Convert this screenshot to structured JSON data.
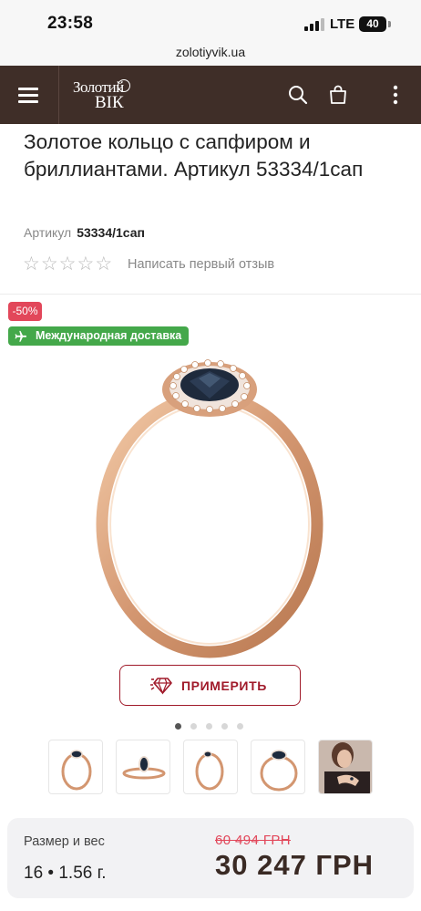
{
  "status_bar": {
    "time": "23:58",
    "network": "LTE",
    "battery": "40"
  },
  "browser": {
    "url": "zolotiyvik.ua"
  },
  "header": {
    "logo_line1": "Золотий",
    "logo_line2": "ВІК",
    "icons": [
      "menu-icon",
      "search-icon",
      "cart-icon",
      "more-vertical-icon"
    ],
    "background_color": "#3f2e28"
  },
  "product": {
    "title": "Золотое кольцо с сапфиром и бриллиантами. Артикул 53334/1сап",
    "sku_label": "Артикул",
    "sku_value": "53334/1сап",
    "rating_stars": 0,
    "rating_max": 5,
    "review_link": "Написать первый отзыв",
    "discount_badge": "-50%",
    "delivery_badge": "Международная доставка",
    "try_on_label": "ПРИМЕРИТЬ",
    "gallery_count": 5,
    "gallery_active": 0
  },
  "price_bar": {
    "size_weight_label": "Размер и вес",
    "size_weight_value": "16 • 1.56 г.",
    "old_price": "60 494 ГРН",
    "new_price": "30 247 ГРН"
  },
  "colors": {
    "accent_red": "#a01a2a",
    "discount_red": "#e2475a",
    "delivery_green": "#44a84a",
    "gold": "#d9a07a"
  }
}
